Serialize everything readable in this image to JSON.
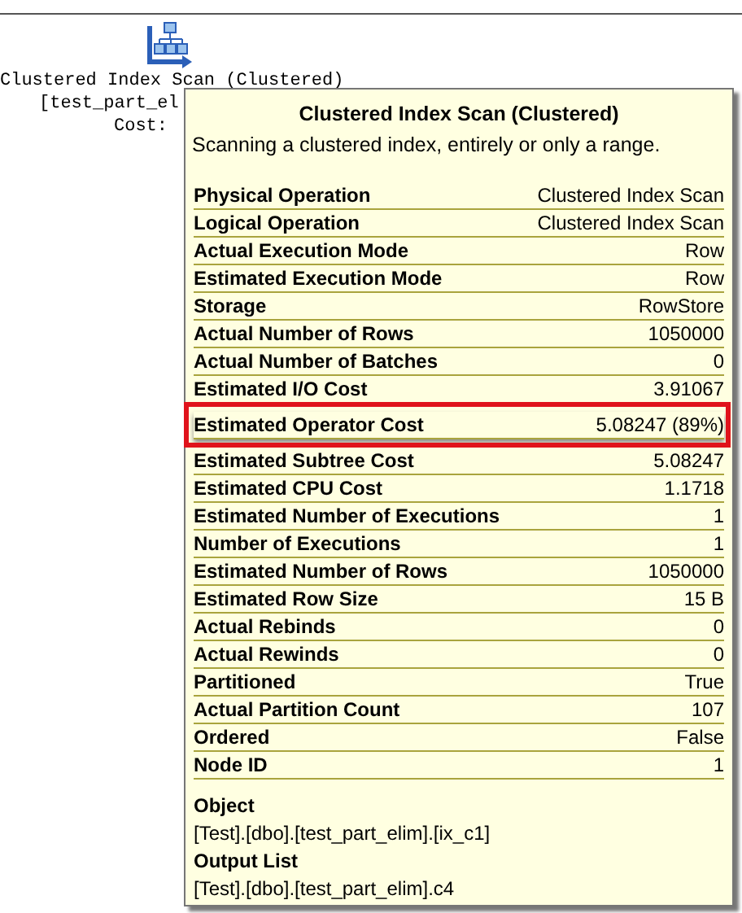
{
  "plan": {
    "operator_label": "Clustered Index Scan (Clustered)",
    "table_label": "[test_part_el",
    "cost_label": "Cost:"
  },
  "tooltip": {
    "title": "Clustered Index Scan (Clustered)",
    "description": "Scanning a clustered index, entirely or only a range.",
    "properties": [
      {
        "name": "Physical Operation",
        "value": "Clustered Index Scan",
        "highlighted": false
      },
      {
        "name": "Logical Operation",
        "value": "Clustered Index Scan",
        "highlighted": false
      },
      {
        "name": "Actual Execution Mode",
        "value": "Row",
        "highlighted": false
      },
      {
        "name": "Estimated Execution Mode",
        "value": "Row",
        "highlighted": false
      },
      {
        "name": "Storage",
        "value": "RowStore",
        "highlighted": false
      },
      {
        "name": "Actual Number of Rows",
        "value": "1050000",
        "highlighted": false
      },
      {
        "name": "Actual Number of Batches",
        "value": "0",
        "highlighted": false
      },
      {
        "name": "Estimated I/O Cost",
        "value": "3.91067",
        "highlighted": false
      },
      {
        "name": "Estimated Operator Cost",
        "value": "5.08247 (89%)",
        "highlighted": true
      },
      {
        "name": "Estimated Subtree Cost",
        "value": "5.08247",
        "highlighted": false
      },
      {
        "name": "Estimated CPU Cost",
        "value": "1.1718",
        "highlighted": false
      },
      {
        "name": "Estimated Number of Executions",
        "value": "1",
        "highlighted": false
      },
      {
        "name": "Number of Executions",
        "value": "1",
        "highlighted": false
      },
      {
        "name": "Estimated Number of Rows",
        "value": "1050000",
        "highlighted": false
      },
      {
        "name": "Estimated Row Size",
        "value": "15 B",
        "highlighted": false
      },
      {
        "name": "Actual Rebinds",
        "value": "0",
        "highlighted": false
      },
      {
        "name": "Actual Rewinds",
        "value": "0",
        "highlighted": false
      },
      {
        "name": "Partitioned",
        "value": "True",
        "highlighted": false
      },
      {
        "name": "Actual Partition Count",
        "value": "107",
        "highlighted": false
      },
      {
        "name": "Ordered",
        "value": "False",
        "highlighted": false
      },
      {
        "name": "Node ID",
        "value": "1",
        "highlighted": false
      }
    ],
    "sections": [
      {
        "heading": "Object",
        "value": "[Test].[dbo].[test_part_elim].[ix_c1]"
      },
      {
        "heading": "Output List",
        "value": "[Test].[dbo].[test_part_elim].c4"
      }
    ]
  }
}
